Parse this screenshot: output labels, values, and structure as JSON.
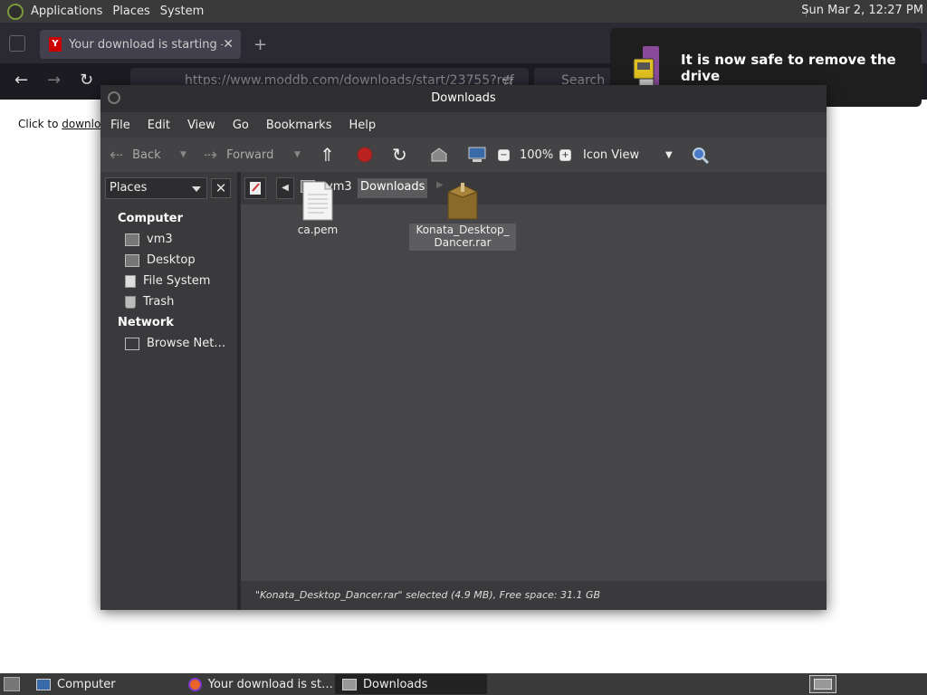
{
  "top_panel": {
    "menus": [
      "Applications",
      "Places",
      "System"
    ],
    "clock": "Sun Mar  2, 12:27 PM"
  },
  "browser": {
    "tab_title": "Your download is starting - M",
    "url": "https://www.moddb.com/downloads/start/23755?ref",
    "search_placeholder": "Search",
    "page_text_prefix": "Click to ",
    "page_link": "download"
  },
  "notification": {
    "text": "It is now safe to remove the drive"
  },
  "file_manager": {
    "title": "Downloads",
    "menu": [
      "File",
      "Edit",
      "View",
      "Go",
      "Bookmarks",
      "Help"
    ],
    "toolbar": {
      "back": "Back",
      "forward": "Forward",
      "zoom": "100%",
      "view_mode": "Icon View"
    },
    "sidebar": {
      "selector": "Places",
      "sections": [
        {
          "header": "Computer",
          "items": [
            "vm3",
            "Desktop",
            "File System",
            "Trash"
          ]
        },
        {
          "header": "Network",
          "items": [
            "Browse Net…"
          ]
        }
      ]
    },
    "breadcrumb": {
      "parent": "vm3",
      "current": "Downloads"
    },
    "files": [
      {
        "name": "ca.pem"
      },
      {
        "name_line1": "Konata_Desktop_",
        "name_line2": "Dancer.rar"
      }
    ],
    "status": "\"Konata_Desktop_Dancer.rar\" selected (4.9 MB), Free space: 31.1 GB"
  },
  "taskbar": {
    "items": [
      "Computer",
      "Your download is st…",
      "Downloads"
    ]
  }
}
